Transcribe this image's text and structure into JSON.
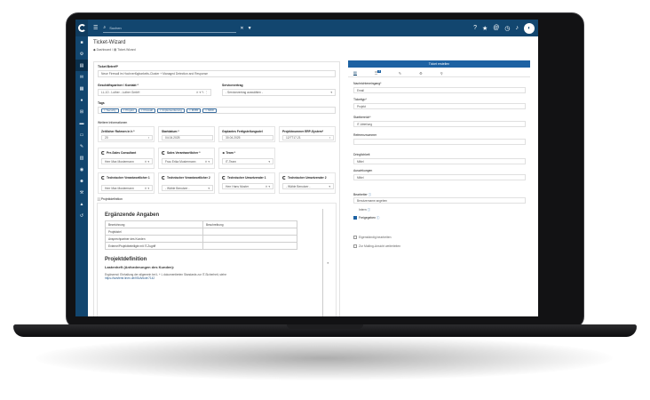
{
  "topbar": {
    "search_placeholder": "Suchen"
  },
  "page": {
    "title": "Ticket-Wizard",
    "breadcrumb_home": "Dashboard",
    "breadcrumb_current": "Ticket-Wizard"
  },
  "form": {
    "betreff_label": "Ticket Betreff*",
    "betreff_value": "Neue Firewall im Hochverfügbarkeits-Cluster + Managed Detection and Response",
    "kontakt_label": "Geschäftspartner / Kontakt *",
    "kontakt_value": "LL-10 - Luther - Luther GmbH",
    "service_label": "Servicevertrag",
    "service_value": "- Servicevertrag auswählen -",
    "tags_label": "Tags",
    "tags": [
      "Security",
      "Projekt",
      "Firewall",
      "Implementierung",
      "M365",
      "MDR"
    ],
    "weitere_label": "Weitere Informationen",
    "rahmen_label": "Zeitlicher Rahmen in h *",
    "rahmen_value": "20",
    "start_label": "Startdatum *",
    "start_value": "04.04.2025",
    "ende_label": "Geplantes Fertigstellungsziel",
    "ende_value": "30.04.2025",
    "projnr_label": "Projektnummer ERP-System*",
    "projnr_value": "12/7717-21",
    "presales_label": "Pre-Sales Consultant",
    "presales_value": "Herr Max Mustermann",
    "sales_label": "Sales Verantwortlicher *",
    "sales_value": "Frau Erika Mustermann",
    "team_label": "Team *",
    "team_value": "IT-Team",
    "tv1_label": "Technischer Verantwortlicher 1",
    "tv1_value": "Herr Max Mustermann",
    "tv2_label": "Technischer Verantwortlicher 2",
    "tv2_value": "- Wähle Benutzer -",
    "tu1_label": "Technischer Umsetzender 1",
    "tu1_value": "Herr Hans Muster",
    "tu2_label": "Technischer Umsetzender 2",
    "tu2_value": "- Wähle Benutzer -",
    "projdef_label": "Projektdefinition",
    "editor_h1": "Ergänzende Angaben",
    "table_headers": [
      "Bezeichnung",
      "Beschreibung"
    ],
    "table_rows": [
      "Projektziel",
      "Ansprechpartner des Kunden",
      "Externe/Projektbeteiligte mit IT-Zugriff"
    ],
    "editor_h2": "Projektdefinition",
    "editor_h3": "Lastenheft (Anforderungen des Kunden):",
    "editor_p": "Ergänzend: Einhaltung der allgemein bei L + L dokumentierten Standards zur IT-Sicherheit, siehe",
    "editor_link": "https://kwsfentr.linen.de/KB/Article/7142"
  },
  "right": {
    "create_button": "Ticket erstellen",
    "tab_badge": "3",
    "nachricht_label": "Nachrichteneingang*",
    "nachricht_value": "Email",
    "tickettyp_label": "Tickettyp*",
    "tickettyp_value": "Projekt",
    "startbereich_label": "Startbereich*",
    "startbereich_value": "IT-Abteilung",
    "referenz_label": "Referenznummer",
    "dringlichkeit_label": "Dringlichkeit",
    "dringlichkeit_value": "Mittel",
    "auswirkungen_label": "Auswirkungen",
    "auswirkungen_value": "Mittel",
    "bearbeiter_label": "Bearbeiter",
    "bearbeiter_value": "Benutzername angeben",
    "intern_label": "Intern",
    "freigegeben_label": "Freigegeben",
    "eigenes_label": "Eigenständig bearbeiten",
    "mailing_label": "Zur Mailing-Ansicht weiterleiten"
  }
}
